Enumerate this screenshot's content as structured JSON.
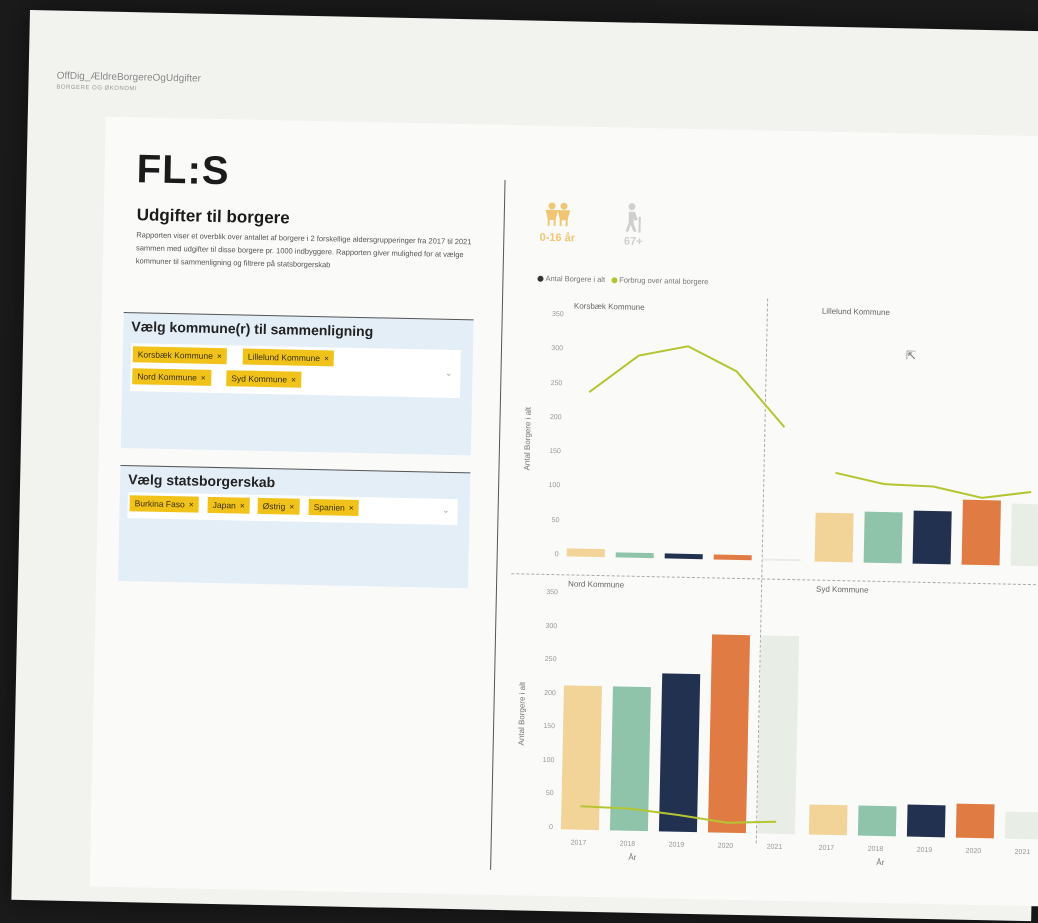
{
  "app": {
    "title": "OffDig_ÆldreBorgereOgUdgifter",
    "subtitle": "BORGERE OG ØKONOMI"
  },
  "report": {
    "logo": "FL:S",
    "heading": "Udgifter til borgere",
    "description": "Rapporten viser et overblik over antallet af borgere i 2 forskellige aldersgrupperinger fra 2017 til 2021 sammen med udgifter til disse borgere pr. 1000 indbyggere. Rapporten giver mulighed for at vælge kommuner til sammenligning og filtrere på statsborgerskab"
  },
  "filters": {
    "kommune": {
      "title": "Vælg kommune(r) til sammenligning",
      "tags": [
        "Korsbæk Kommune",
        "Lillelund Kommune",
        "Nord Kommune",
        "Syd Kommune"
      ]
    },
    "statsborgerskab": {
      "title": "Vælg statsborgerskab",
      "tags": [
        "Burkina Faso",
        "Japan",
        "Østrig",
        "Spanien"
      ]
    },
    "remove_glyph": "×",
    "chevron_glyph": "⌄"
  },
  "age_groups": [
    {
      "label": "0-16 år",
      "active": true,
      "color": "#f0c674",
      "icon": "children-icon"
    },
    {
      "label": "67+",
      "active": false,
      "color": "#d0d0d0",
      "icon": "elderly-walking-icon"
    }
  ],
  "legend": {
    "items": [
      {
        "label": "Antal Borgere i alt",
        "color": "#333333"
      },
      {
        "label": "Forbrug over antal borgere",
        "color": "#b5c532"
      }
    ]
  },
  "chart_meta": {
    "y_axis_label": "Antal Borgere i alt",
    "x_axis_label": "År",
    "y_ticks": [
      0,
      50,
      100,
      150,
      200,
      250,
      300,
      350
    ],
    "years": [
      "2017",
      "2018",
      "2019",
      "2020",
      "2021"
    ],
    "bar_colors": [
      "#f2d398",
      "#8fc4ab",
      "#233150",
      "#e07b43",
      "#e8ede6"
    ],
    "line_color": "#b5c532"
  },
  "chart_data": [
    {
      "type": "bar",
      "title": "Korsbæk Kommune",
      "categories": [
        "2017",
        "2018",
        "2019",
        "2020",
        "2021"
      ],
      "values": [
        12,
        8,
        7,
        8,
        2
      ],
      "line_values": [
        240,
        295,
        310,
        275,
        195
      ],
      "ylim": [
        0,
        350
      ]
    },
    {
      "type": "bar",
      "title": "Lillelund Kommune",
      "categories": [
        "2017",
        "2018",
        "2019",
        "2020",
        "2021"
      ],
      "values": [
        72,
        75,
        77,
        95,
        90
      ],
      "line_values": [
        130,
        115,
        113,
        98,
        108
      ],
      "ylim": [
        0,
        350
      ]
    },
    {
      "type": "bar",
      "title": "Nord Kommune",
      "categories": [
        "2017",
        "2018",
        "2019",
        "2020",
        "2021"
      ],
      "values": [
        215,
        215,
        235,
        295,
        295
      ],
      "line_values": [
        35,
        33,
        25,
        15,
        18
      ],
      "ylim": [
        0,
        350
      ]
    },
    {
      "type": "bar",
      "title": "Syd Kommune",
      "categories": [
        "2017",
        "2018",
        "2019",
        "2020",
        "2021"
      ],
      "values": [
        45,
        45,
        48,
        50,
        40
      ],
      "line_values": [],
      "ylim": [
        0,
        350
      ]
    }
  ]
}
